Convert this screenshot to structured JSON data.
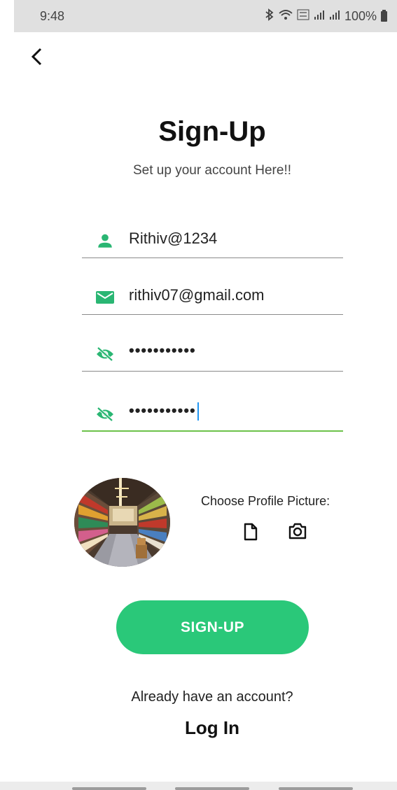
{
  "status_bar": {
    "time": "9:48",
    "battery": "100%",
    "icons": [
      "bluetooth-icon",
      "wifi-icon",
      "volte-icon",
      "signal-icon",
      "signal-icon",
      "battery-icon"
    ]
  },
  "header": {
    "title": "Sign-Up",
    "subtitle": "Set up your account Here!!"
  },
  "form": {
    "username": {
      "value": "Rithiv@1234",
      "icon": "person-icon"
    },
    "email": {
      "value": "rithiv07@gmail.com",
      "icon": "mail-icon"
    },
    "password": {
      "value": "•••••••••••",
      "icon": "visibility-off-icon"
    },
    "confirm_password": {
      "value": "•••••••••••",
      "icon": "visibility-off-icon"
    }
  },
  "profile": {
    "choose_label": "Choose Profile Picture:",
    "file_icon": "file-icon",
    "camera_icon": "camera-icon"
  },
  "actions": {
    "signup_label": "SIGN-UP",
    "already_text": "Already have an account?",
    "login_label": "Log In"
  },
  "colors": {
    "accent": "#2ac879",
    "icon_green": "#2ab673",
    "focus_line": "#6cc24a",
    "cursor": "#2196f3"
  }
}
